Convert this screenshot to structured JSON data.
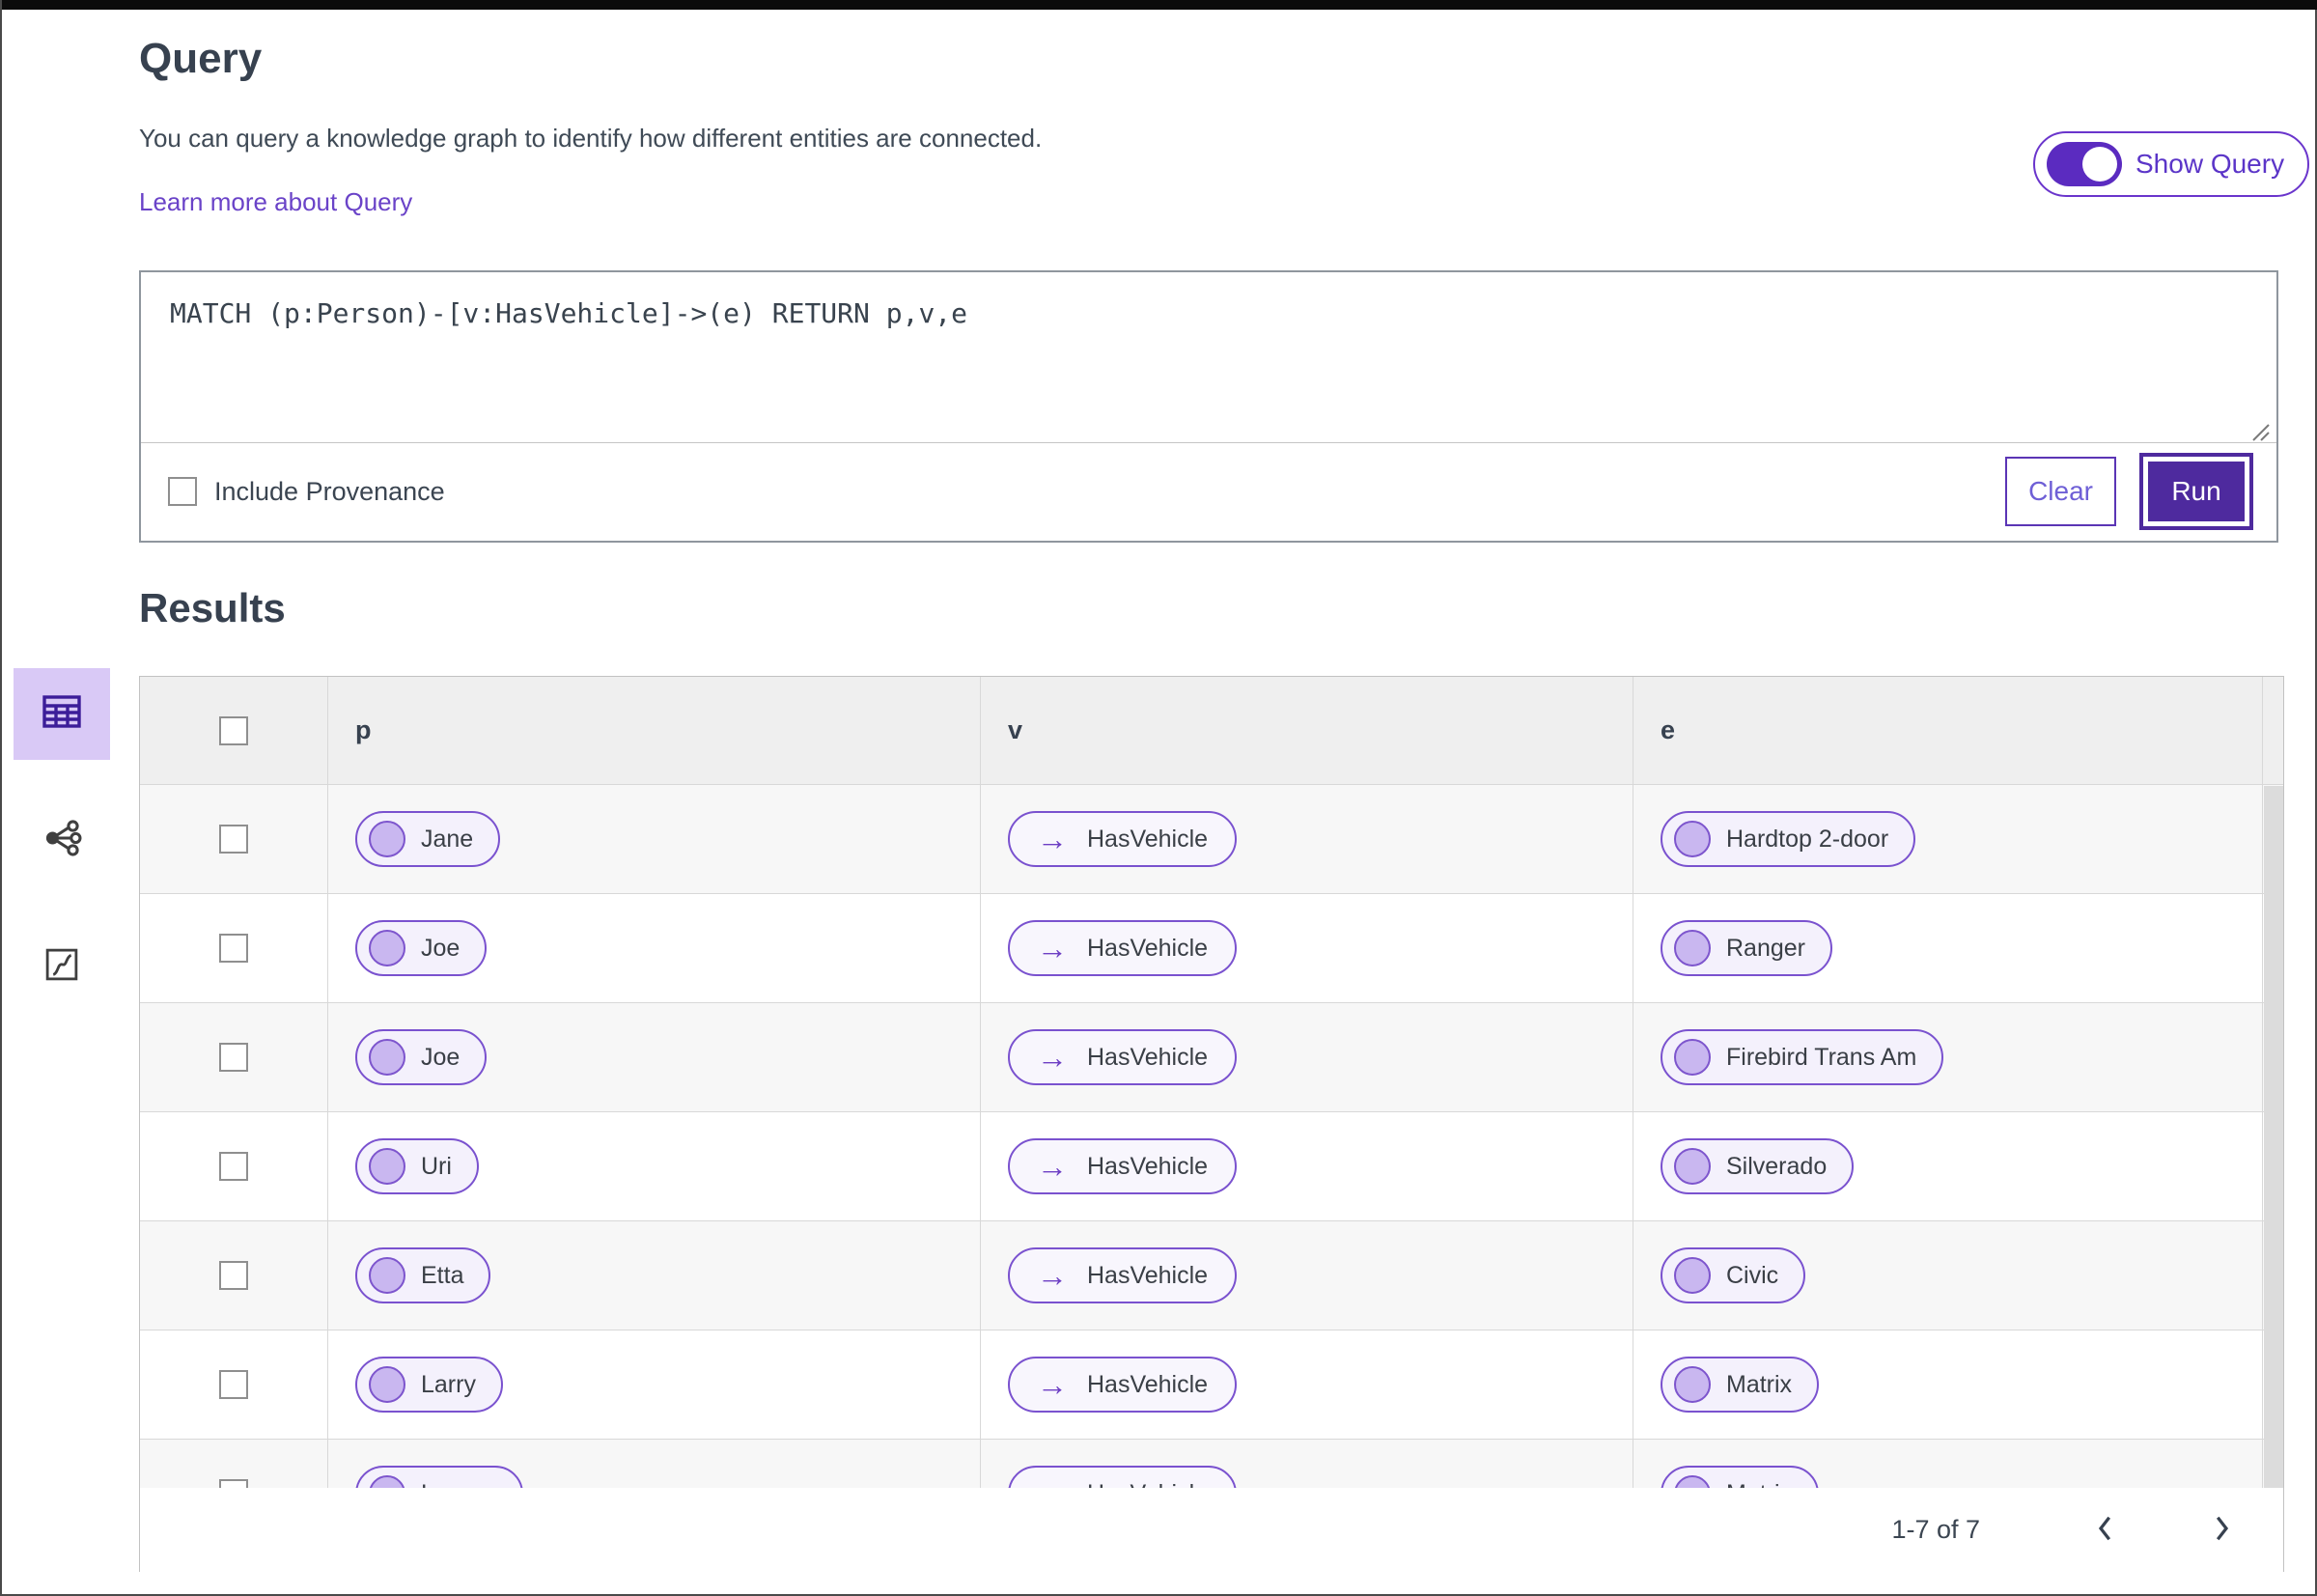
{
  "colors": {
    "accent_purple": "#5b2bc0",
    "run_button": "#4e2a9e",
    "pill_border": "#7a52cf",
    "pill_bg": "#f4f1fc",
    "selected_view_bg": "#d9c9f6",
    "link": "#6a43c8",
    "header_row_bg": "#efefef",
    "alt_row_bg": "#f7f7f7"
  },
  "header": {
    "title": "Query",
    "description": "You can query a knowledge graph to identify how different entities are connected.",
    "link_label": "Learn more about Query",
    "toggle_label": "Show Query",
    "toggle_on": true
  },
  "query_editor": {
    "query": "MATCH (p:Person)-[v:HasVehicle]->(e) RETURN p,v,e",
    "include_provenance_label": "Include Provenance",
    "include_provenance_checked": false,
    "clear_label": "Clear",
    "run_label": "Run"
  },
  "sidebar": {
    "items": [
      {
        "name": "table-view",
        "icon": "table-icon",
        "selected": true
      },
      {
        "name": "graph-view",
        "icon": "network-icon",
        "selected": false
      },
      {
        "name": "chart-view",
        "icon": "curve-box-icon",
        "selected": false
      }
    ]
  },
  "results": {
    "title": "Results",
    "columns": [
      "p",
      "v",
      "e"
    ],
    "edge_arrow": "→",
    "rows": [
      {
        "p": "Jane",
        "v": "HasVehicle",
        "e": "Hardtop 2-door"
      },
      {
        "p": "Joe",
        "v": "HasVehicle",
        "e": "Ranger"
      },
      {
        "p": "Joe",
        "v": "HasVehicle",
        "e": "Firebird Trans Am"
      },
      {
        "p": "Uri",
        "v": "HasVehicle",
        "e": "Silverado"
      },
      {
        "p": "Etta",
        "v": "HasVehicle",
        "e": "Civic"
      },
      {
        "p": "Larry",
        "v": "HasVehicle",
        "e": "Matrix"
      },
      {
        "p": "Lauren",
        "v": "HasVehicle",
        "e": "Matrix"
      }
    ],
    "pagination": {
      "range": "1-7 of 7"
    }
  }
}
